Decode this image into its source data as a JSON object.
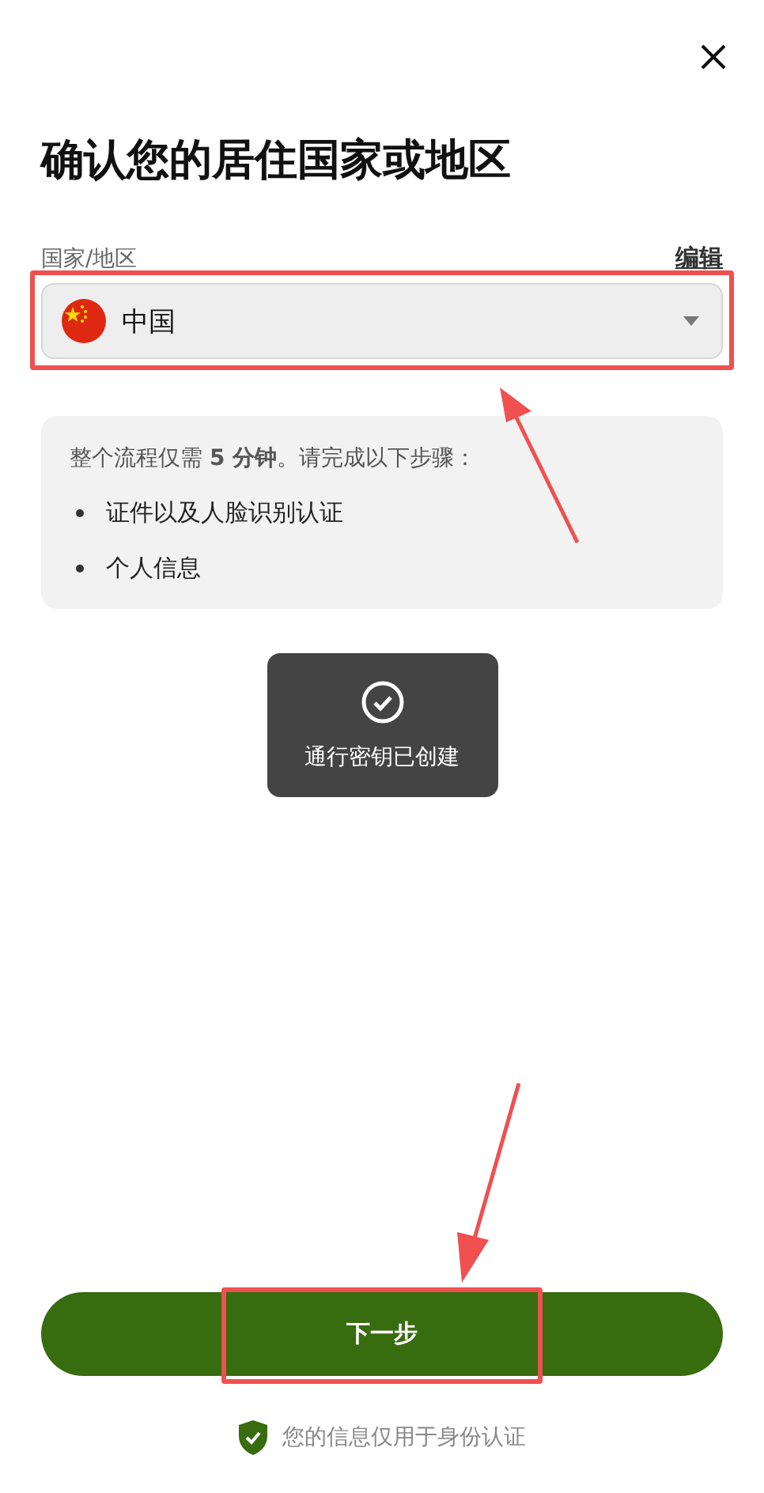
{
  "title": "确认您的居住国家或地区",
  "country_field": {
    "label": "国家/地区",
    "edit_link": "编辑",
    "value": "中国"
  },
  "info_card": {
    "intro": "整个流程仅需 **5 分钟**。请完成以下步骤：",
    "steps": [
      "证件以及人脸识别认证",
      "个人信息"
    ]
  },
  "toast": {
    "message": "通行密钥已创建"
  },
  "next_button": {
    "label": "下一步"
  },
  "privacy_note": "您的信息仅用于身份认证"
}
